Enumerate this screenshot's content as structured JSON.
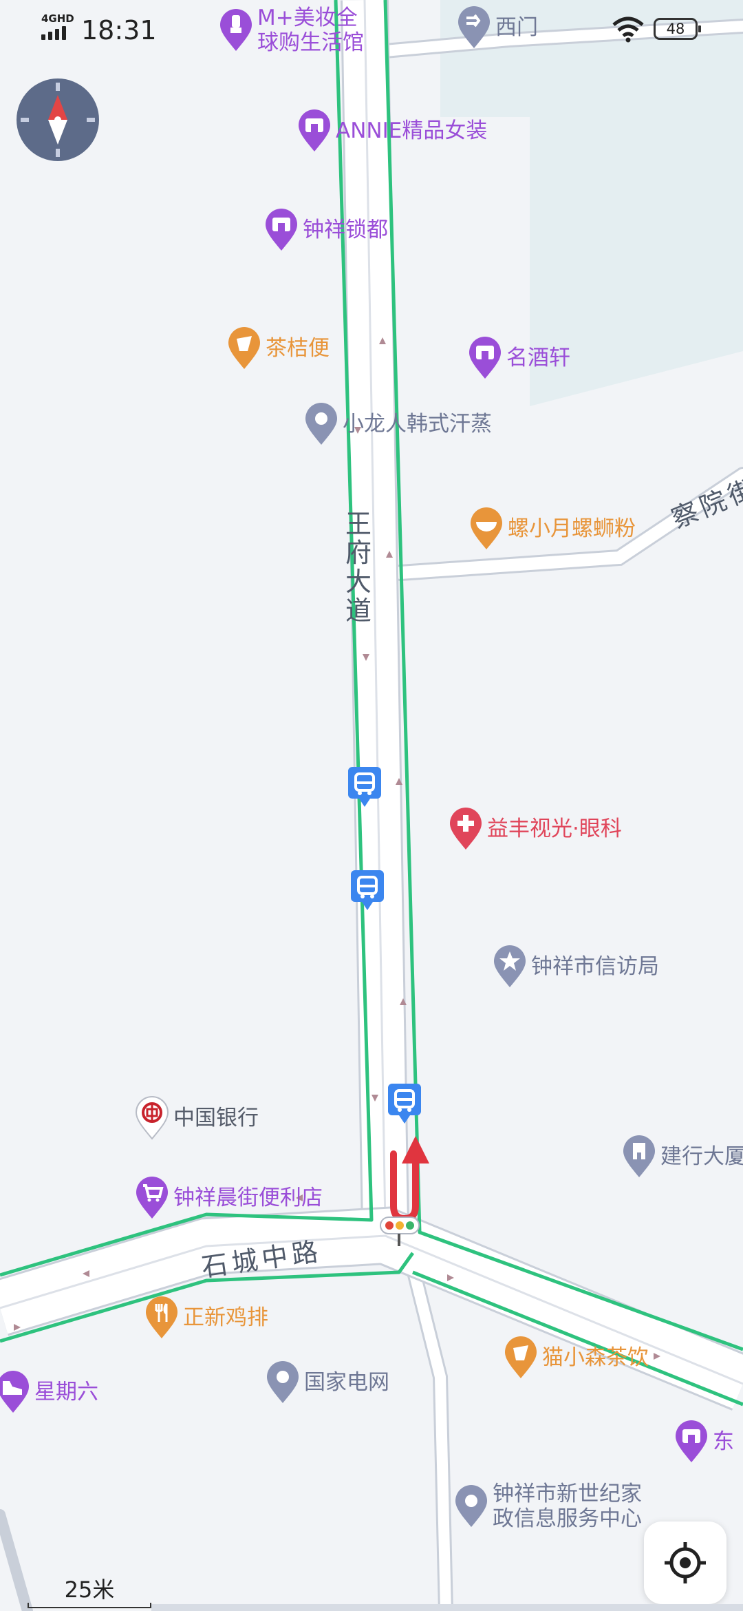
{
  "status_bar": {
    "network": "4GHD",
    "time": "18:31",
    "battery": "48"
  },
  "roads": {
    "main_vertical": "王府大道",
    "main_horizontal": "石城中路",
    "upper_right": "察院街"
  },
  "pois": [
    {
      "id": "meizhuang",
      "label": "M+美妆全\n球购生活馆",
      "icon": "lipstick-icon",
      "color": "#9a4ed8"
    },
    {
      "id": "ximen",
      "label": "西门",
      "icon": "gate-icon",
      "color": "#8a93b3"
    },
    {
      "id": "annie",
      "label": "ANNIE精品女装",
      "icon": "shop-icon",
      "color": "#9a4ed8"
    },
    {
      "id": "suodu",
      "label": "钟祥锁都",
      "icon": "shop-icon",
      "color": "#9a4ed8"
    },
    {
      "id": "chajiebian",
      "label": "茶桔便",
      "icon": "drink-icon",
      "color": "#e8953a"
    },
    {
      "id": "mingjiuxuan",
      "label": "名酒轩",
      "icon": "shop-icon",
      "color": "#9a4ed8"
    },
    {
      "id": "xiaolongren",
      "label": "小龙人韩式汗蒸",
      "icon": "location-pin-icon",
      "color": "#8a93b3"
    },
    {
      "id": "luoxiaoyue",
      "label": "螺小月螺蛳粉",
      "icon": "noodle-icon",
      "color": "#e8953a"
    },
    {
      "id": "yifeng",
      "label": "益丰视光·眼科",
      "icon": "medical-cross-icon",
      "color": "#e0455a"
    },
    {
      "id": "xinfangju",
      "label": "钟祥市信访局",
      "icon": "government-star-icon",
      "color": "#8a93b3"
    },
    {
      "id": "zhongguoyinhang",
      "label": "中国银行",
      "icon": "bank-of-china-icon",
      "color": "#c8232c"
    },
    {
      "id": "jianhang",
      "label": "建行大厦",
      "icon": "building-icon",
      "color": "#8a93b3"
    },
    {
      "id": "bianlidian",
      "label": "钟祥晨街便利店",
      "icon": "cart-icon",
      "color": "#9a4ed8"
    },
    {
      "id": "zhengxin",
      "label": "正新鸡排",
      "icon": "fork-knife-icon",
      "color": "#e8953a"
    },
    {
      "id": "maoxiaosen",
      "label": "猫小森茶饮",
      "icon": "drink-icon",
      "color": "#e8953a"
    },
    {
      "id": "xingqiliu",
      "label": "星期六",
      "icon": "shoe-icon",
      "color": "#9a4ed8"
    },
    {
      "id": "guojiadianwang",
      "label": "国家电网",
      "icon": "location-pin-icon",
      "color": "#8a93b3"
    },
    {
      "id": "dong",
      "label": "东",
      "icon": "shop-icon",
      "color": "#9a4ed8"
    },
    {
      "id": "xinshiji",
      "label": "钟祥市新世纪家\n政信息服务中心",
      "icon": "location-pin-icon",
      "color": "#8a93b3"
    }
  ],
  "scale": {
    "label": "25米"
  },
  "colors": {
    "route": "#2ec27e",
    "road_fill": "#ffffff",
    "road_edge": "#c9cfd9",
    "background": "#f2f4f7",
    "campus": "#e4eef1",
    "bus": "#3b86ef",
    "uturn": "#e0353f",
    "compass": "#5d6b89"
  }
}
